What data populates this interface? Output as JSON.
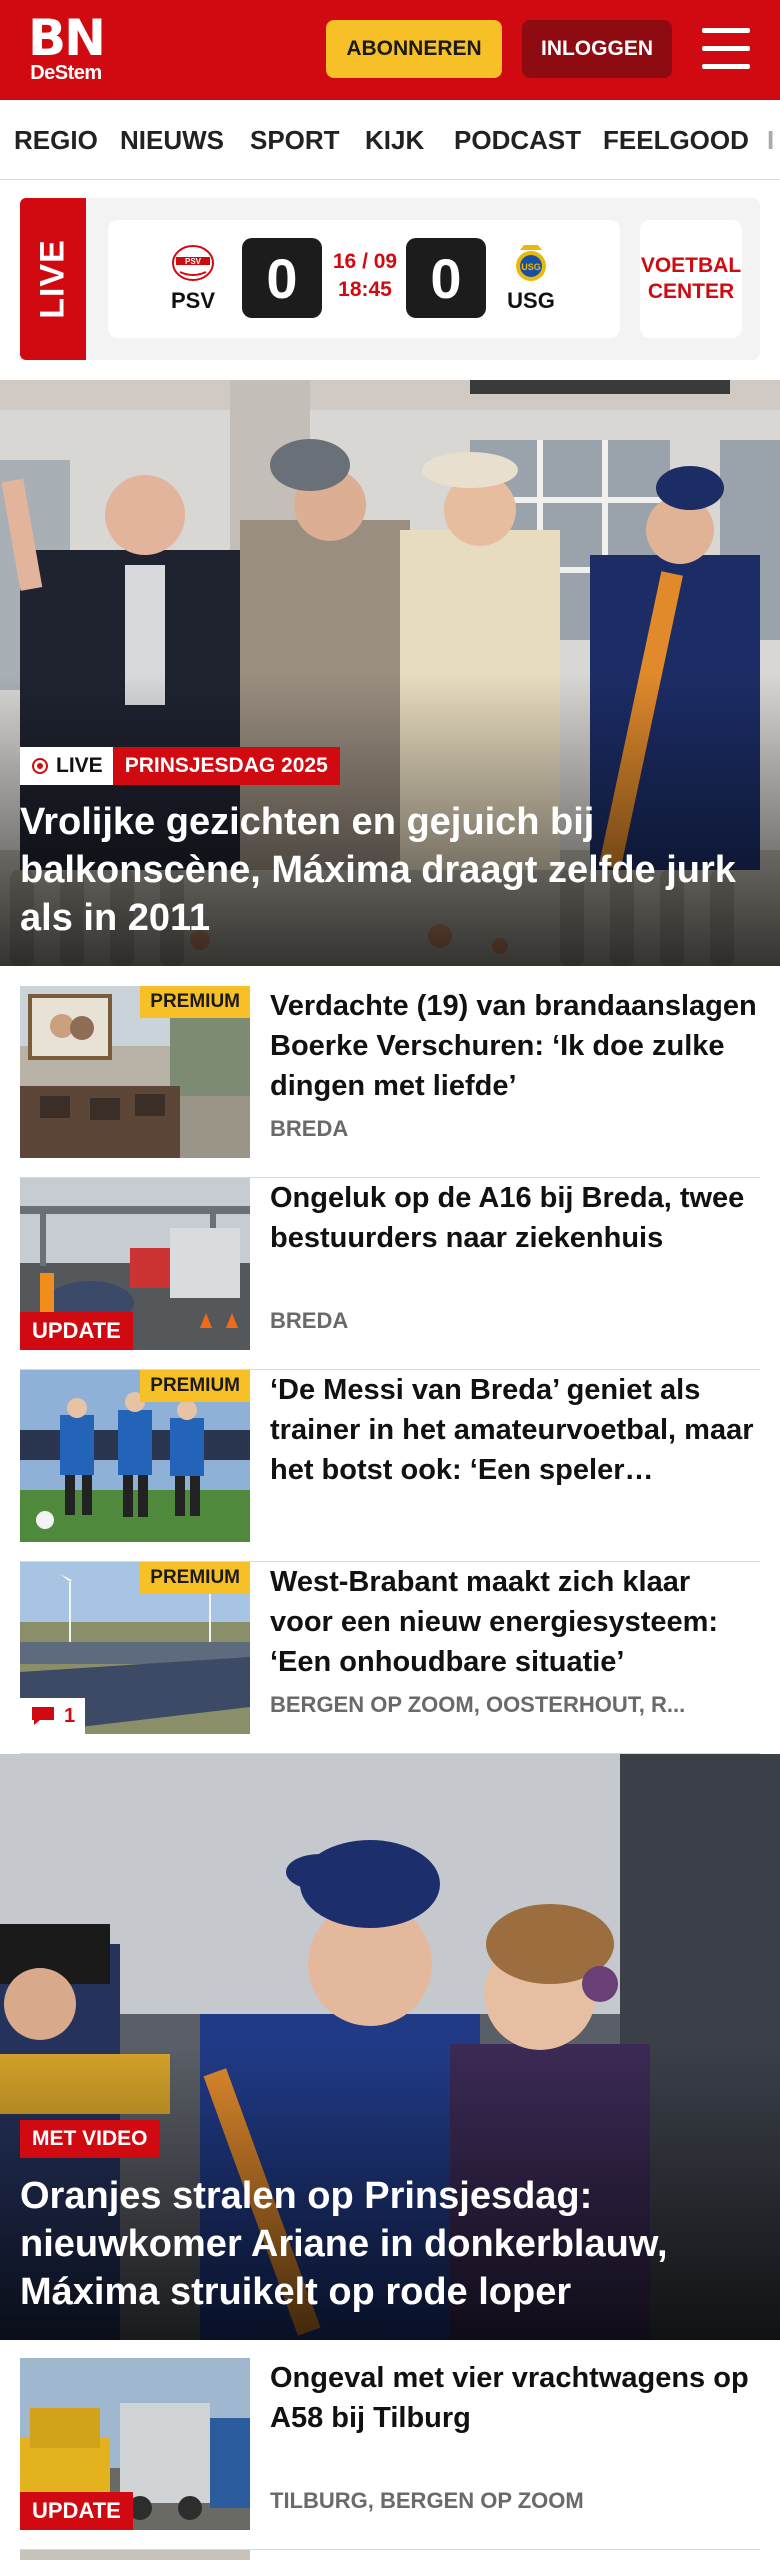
{
  "header": {
    "logo_main": "BN",
    "logo_sub": "DeStem",
    "subscribe_label": "ABONNEREN",
    "login_label": "INLOGGEN",
    "colors": {
      "brand": "#d10a11",
      "accent": "#f6c026",
      "login_bg": "#8e0b12"
    }
  },
  "nav": {
    "items": [
      "REGIO",
      "NIEUWS",
      "SPORT",
      "KIJK",
      "PODCAST",
      "FEELGOOD",
      "I"
    ]
  },
  "live_score": {
    "live_label": "LIVE",
    "home": {
      "name": "PSV",
      "score": "0",
      "crest_icon": "psv-crest-icon"
    },
    "away": {
      "name": "USG",
      "score": "0",
      "crest_icon": "usg-crest-icon"
    },
    "date": "16 / 09",
    "time": "18:45",
    "center_label_1": "VOETBAL",
    "center_label_2": "CENTER"
  },
  "hero": {
    "live_tag": "LIVE",
    "category_tag": "PRINSJESDAG 2025",
    "title": "Vrolijke gezichten en gejuich bij balkonscène, Máxima draagt zelfde jurk als in 2011"
  },
  "articles": [
    {
      "title": "Verdachte (19) van brandaansla­gen Boerke Verschuren: ‘Ik doe zulke dingen met liefde’",
      "location": "BREDA",
      "badge": "PREMIUM"
    },
    {
      "title": "Ongeluk op de A16 bij Breda, twee bestuurders naar ziekenhuis",
      "location": "BREDA",
      "badge": "UPDATE"
    },
    {
      "title": "‘De Messi van Breda’ geniet als trainer in het amateurvoetbal, maar het botst ook: ‘Een speler…",
      "location": "",
      "badge": "PREMIUM"
    },
    {
      "title": "West-Brabant maakt zich klaar voor een nieuw energiesysteem: ‘Een onhoudbare situatie’",
      "location": "BERGEN OP ZOOM, OOSTERHOUT, R...",
      "badge": "PREMIUM",
      "comments": "1"
    }
  ],
  "hero2": {
    "tag": "MET VIDEO",
    "title": "Oranjes stralen op Prinsjesdag: nieuwkomer Ariane in donkerblauw, Máxima struikelt op rode loper"
  },
  "articles2": [
    {
      "title": "Ongeval met vier vrachtwagens op A58 bij Tilburg",
      "location": "TILBURG, BERGEN OP ZOOM",
      "badge": "UPDATE"
    }
  ]
}
